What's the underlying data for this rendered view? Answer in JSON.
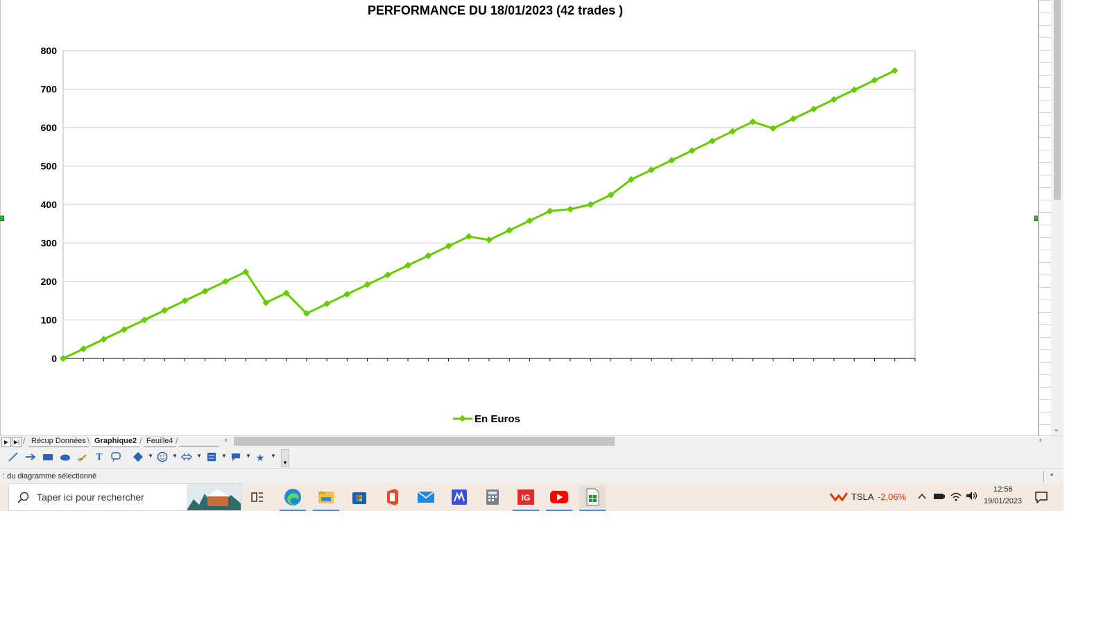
{
  "chart_data": {
    "type": "line",
    "title": "PERFORMANCE DU 18/01/2023 (42 trades )",
    "ylim": [
      0,
      800
    ],
    "yticks": [
      "0",
      "100",
      "200",
      "300",
      "400",
      "500",
      "600",
      "700",
      "800"
    ],
    "grid": true,
    "legend_position": "bottom",
    "series": [
      {
        "name": "En Euros",
        "color": "#66cc00",
        "values": [
          0,
          25,
          50,
          75,
          100,
          125,
          150,
          175,
          200,
          225,
          145,
          170,
          117,
          142,
          167,
          192,
          217,
          242,
          267,
          292,
          317,
          308,
          333,
          358,
          383,
          388,
          400,
          425,
          465,
          490,
          515,
          540,
          565,
          590,
          615,
          598,
          623,
          648,
          673,
          698,
          723,
          748
        ]
      }
    ]
  },
  "sheet_tabs": [
    "Récup Données",
    "Graphique2",
    "Feuille4"
  ],
  "active_tab": "Graphique2",
  "status_text": ": du diagramme sélectionné",
  "status_indicator": "*",
  "taskbar": {
    "search_placeholder": "Taper ici pour rechercher",
    "apps": [
      "task-view",
      "edge",
      "file-explorer",
      "microsoft-store",
      "office",
      "mail",
      "trading-app",
      "calculator",
      "ig",
      "youtube",
      "libreoffice-calc"
    ],
    "ticker": "TSLA",
    "ticker_change": "-2,06%",
    "time": "12:56",
    "date": "19/01/2023"
  }
}
